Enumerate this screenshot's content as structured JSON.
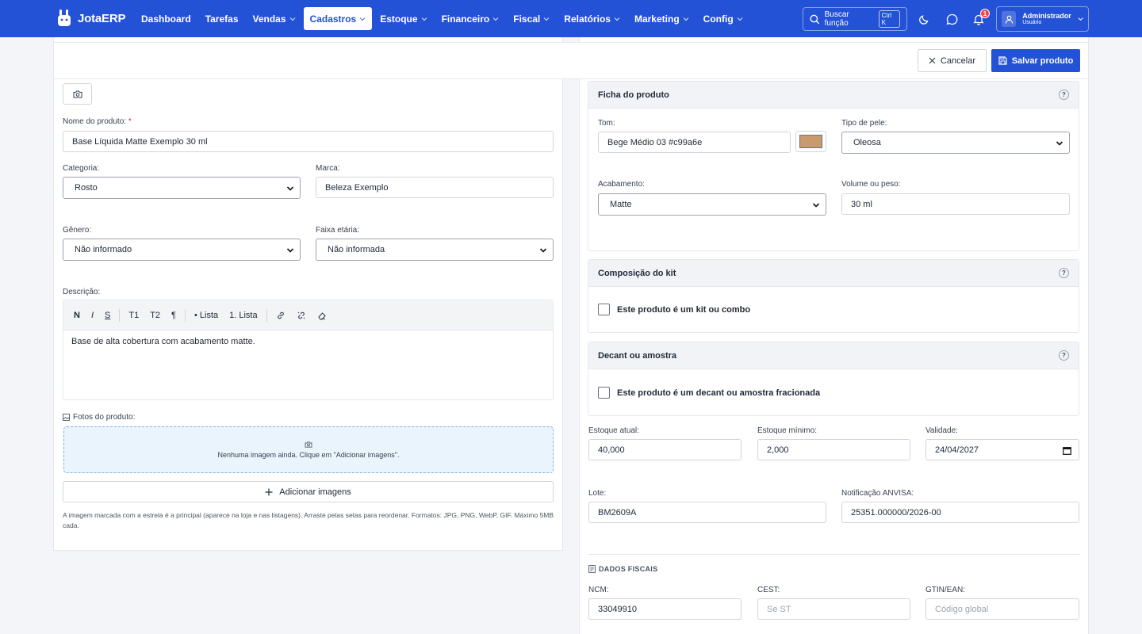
{
  "brand": {
    "name": "JotaERP"
  },
  "nav": {
    "items": [
      {
        "label": "Dashboard",
        "chevron": false,
        "active": false
      },
      {
        "label": "Tarefas",
        "chevron": false,
        "active": false
      },
      {
        "label": "Vendas",
        "chevron": true,
        "active": false
      },
      {
        "label": "Cadastros",
        "chevron": true,
        "active": true
      },
      {
        "label": "Estoque",
        "chevron": true,
        "active": false
      },
      {
        "label": "Financeiro",
        "chevron": true,
        "active": false
      },
      {
        "label": "Fiscal",
        "chevron": true,
        "active": false
      },
      {
        "label": "Relatórios",
        "chevron": true,
        "active": false
      },
      {
        "label": "Marketing",
        "chevron": true,
        "active": false
      },
      {
        "label": "Config",
        "chevron": true,
        "active": false
      }
    ],
    "search_label": "Buscar função",
    "search_shortcut": "Ctrl K",
    "notifications_count": "1",
    "user_name": "Administrador",
    "user_role": "Usuário"
  },
  "actions": {
    "cancel": "Cancelar",
    "save": "Salvar produto"
  },
  "form": {
    "nome_label": "Nome do produto:",
    "nome_required": "*",
    "nome_value": "Base Líquida Matte Exemplo 30 ml",
    "categoria_label": "Categoria:",
    "categoria_value": "Rosto",
    "marca_label": "Marca:",
    "marca_value": "Beleza Exemplo",
    "genero_label": "Gênero:",
    "genero_value": "Não informado",
    "faixa_label": "Faixa etária:",
    "faixa_value": "Não informada",
    "descricao_label": "Descrição:",
    "toolbar": [
      "N",
      "I",
      "S",
      "T1",
      "T2",
      "¶",
      "• Lista",
      "1. Lista"
    ],
    "descricao_value": "Base de alta cobertura com acabamento matte.",
    "fotos_label": "Fotos do produto:",
    "dropzone_text": "Nenhuma imagem ainda. Clique em \"Adicionar imagens\".",
    "add_images": "Adicionar imagens",
    "hint": "A imagem marcada com a estrela é a principal (aparece na loja e nas listagens). Arraste pelas setas para reordenar. Formatos: JPG, PNG, WebP, GIF. Máximo 5MB cada."
  },
  "ficha": {
    "title": "Ficha do produto",
    "help": "?",
    "tom_label": "Tom:",
    "tom_value": "Bege Médio 03 #c99a6e",
    "tom_color": "#c99a6e",
    "pele_label": "Tipo de pele:",
    "pele_value": "Oleosa",
    "acabamento_label": "Acabamento:",
    "acabamento_value": "Matte",
    "volume_label": "Volume ou peso:",
    "volume_value": "30 ml"
  },
  "kit": {
    "title": "Composição do kit",
    "help": "?",
    "check_label": "Este produto é um kit ou combo"
  },
  "decant": {
    "title": "Decant ou amostra",
    "help": "?",
    "check_label": "Este produto é um decant ou amostra fracionada"
  },
  "estoque": {
    "atual_label": "Estoque atual:",
    "atual_value": "40,000",
    "minimo_label": "Estoque mínimo:",
    "minimo_value": "2,000",
    "validade_label": "Validade:",
    "validade_value": "24/04/2027",
    "lote_label": "Lote:",
    "lote_value": "BM2609A",
    "anvisa_label": "Notificação ANVISA:",
    "anvisa_value": "25351.000000/2026-00"
  },
  "fiscal": {
    "section_title": "DADOS FISCAIS",
    "ncm_label": "NCM:",
    "ncm_value": "33049910",
    "cest_label": "CEST:",
    "cest_placeholder": "Se ST",
    "gtin_label": "GTIN/EAN:",
    "gtin_placeholder": "Código global"
  }
}
